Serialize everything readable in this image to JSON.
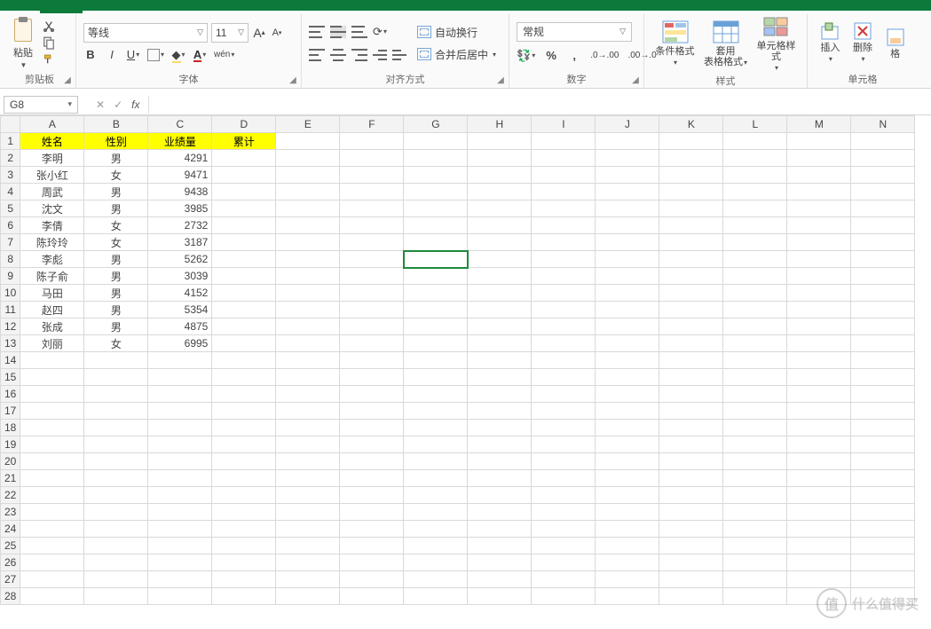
{
  "namebox": "G8",
  "ribbon": {
    "clipboard": {
      "paste": "粘贴",
      "label": "剪贴板"
    },
    "font": {
      "family": "等线",
      "size": "11",
      "label": "字体",
      "btn_pinyin": "wén"
    },
    "align": {
      "wrap": "自动换行",
      "merge": "合并后居中",
      "label": "对齐方式"
    },
    "number": {
      "format": "常规",
      "label": "数字"
    },
    "styles": {
      "cond": "条件格式",
      "tablefmt1": "套用",
      "tablefmt2": "表格格式",
      "cellstyle": "单元格样式",
      "label": "样式"
    },
    "cells": {
      "insert": "插入",
      "delete": "删除",
      "format": "格",
      "label": "单元格"
    }
  },
  "columns": [
    "A",
    "B",
    "C",
    "D",
    "E",
    "F",
    "G",
    "H",
    "I",
    "J",
    "K",
    "L",
    "M",
    "N"
  ],
  "headers": {
    "A": "姓名",
    "B": "性别",
    "C": "业绩量",
    "D": "累计"
  },
  "rows": [
    {
      "a": "李明",
      "b": "男",
      "c": "4291"
    },
    {
      "a": "张小红",
      "b": "女",
      "c": "9471"
    },
    {
      "a": "周武",
      "b": "男",
      "c": "9438"
    },
    {
      "a": "沈文",
      "b": "男",
      "c": "3985"
    },
    {
      "a": "李倩",
      "b": "女",
      "c": "2732"
    },
    {
      "a": "陈玲玲",
      "b": "女",
      "c": "3187"
    },
    {
      "a": "李彪",
      "b": "男",
      "c": "5262"
    },
    {
      "a": "陈子俞",
      "b": "男",
      "c": "3039"
    },
    {
      "a": "马田",
      "b": "男",
      "c": "4152"
    },
    {
      "a": "赵四",
      "b": "男",
      "c": "5354"
    },
    {
      "a": "张成",
      "b": "男",
      "c": "4875"
    },
    {
      "a": "刘丽",
      "b": "女",
      "c": "6995"
    }
  ],
  "total_rows": 28,
  "watermark": {
    "char": "值",
    "text": "什么值得买"
  }
}
